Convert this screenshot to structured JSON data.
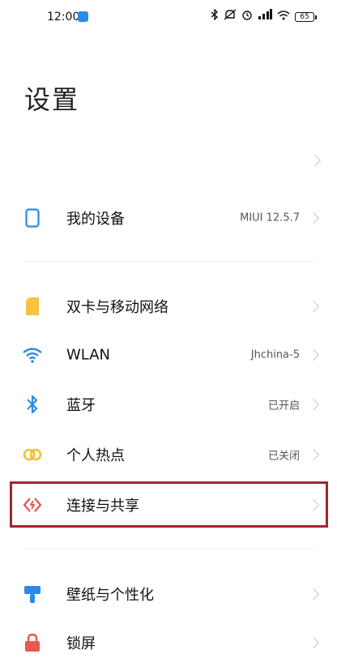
{
  "status_bar": {
    "time": "12:00",
    "battery": "65",
    "icons": [
      "bluetooth-icon",
      "silent-icon",
      "alarm-icon",
      "signal-icon",
      "wifi-icon",
      "battery-icon"
    ]
  },
  "page": {
    "title": "设置"
  },
  "settings": {
    "items": [
      {
        "label": "我的设备",
        "value": "MIUI 12.5.7",
        "icon": "phone-icon"
      },
      {
        "label": "双卡与移动网络",
        "value": "",
        "icon": "sim-card-icon"
      },
      {
        "label": "WLAN",
        "value": "Jhchina-5",
        "icon": "wifi-icon"
      },
      {
        "label": "蓝牙",
        "value": "已开启",
        "icon": "bluetooth-icon"
      },
      {
        "label": "个人热点",
        "value": "已关闭",
        "icon": "hotspot-icon"
      },
      {
        "label": "连接与共享",
        "value": "",
        "icon": "connection-share-icon"
      },
      {
        "label": "壁纸与个性化",
        "value": "",
        "icon": "wallpaper-icon"
      },
      {
        "label": "锁屏",
        "value": "",
        "icon": "lock-icon"
      }
    ]
  },
  "colors": {
    "accent_blue": "#2a8ae8",
    "sim_yellow": "#f5c242",
    "hotspot_yellow": "#f2c02e",
    "connect_red": "#e35b4f",
    "lock_red": "#e85a4f",
    "highlight_border": "#a3262a"
  }
}
